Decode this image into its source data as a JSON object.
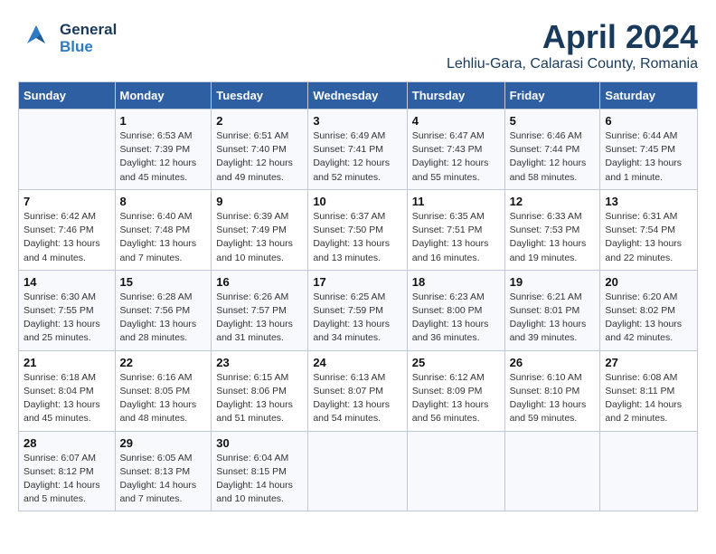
{
  "header": {
    "logo_general": "General",
    "logo_blue": "Blue",
    "month_title": "April 2024",
    "location": "Lehliu-Gara, Calarasi County, Romania"
  },
  "weekdays": [
    "Sunday",
    "Monday",
    "Tuesday",
    "Wednesday",
    "Thursday",
    "Friday",
    "Saturday"
  ],
  "weeks": [
    [
      {
        "day": "",
        "info": ""
      },
      {
        "day": "1",
        "info": "Sunrise: 6:53 AM\nSunset: 7:39 PM\nDaylight: 12 hours\nand 45 minutes."
      },
      {
        "day": "2",
        "info": "Sunrise: 6:51 AM\nSunset: 7:40 PM\nDaylight: 12 hours\nand 49 minutes."
      },
      {
        "day": "3",
        "info": "Sunrise: 6:49 AM\nSunset: 7:41 PM\nDaylight: 12 hours\nand 52 minutes."
      },
      {
        "day": "4",
        "info": "Sunrise: 6:47 AM\nSunset: 7:43 PM\nDaylight: 12 hours\nand 55 minutes."
      },
      {
        "day": "5",
        "info": "Sunrise: 6:46 AM\nSunset: 7:44 PM\nDaylight: 12 hours\nand 58 minutes."
      },
      {
        "day": "6",
        "info": "Sunrise: 6:44 AM\nSunset: 7:45 PM\nDaylight: 13 hours\nand 1 minute."
      }
    ],
    [
      {
        "day": "7",
        "info": "Sunrise: 6:42 AM\nSunset: 7:46 PM\nDaylight: 13 hours\nand 4 minutes."
      },
      {
        "day": "8",
        "info": "Sunrise: 6:40 AM\nSunset: 7:48 PM\nDaylight: 13 hours\nand 7 minutes."
      },
      {
        "day": "9",
        "info": "Sunrise: 6:39 AM\nSunset: 7:49 PM\nDaylight: 13 hours\nand 10 minutes."
      },
      {
        "day": "10",
        "info": "Sunrise: 6:37 AM\nSunset: 7:50 PM\nDaylight: 13 hours\nand 13 minutes."
      },
      {
        "day": "11",
        "info": "Sunrise: 6:35 AM\nSunset: 7:51 PM\nDaylight: 13 hours\nand 16 minutes."
      },
      {
        "day": "12",
        "info": "Sunrise: 6:33 AM\nSunset: 7:53 PM\nDaylight: 13 hours\nand 19 minutes."
      },
      {
        "day": "13",
        "info": "Sunrise: 6:31 AM\nSunset: 7:54 PM\nDaylight: 13 hours\nand 22 minutes."
      }
    ],
    [
      {
        "day": "14",
        "info": "Sunrise: 6:30 AM\nSunset: 7:55 PM\nDaylight: 13 hours\nand 25 minutes."
      },
      {
        "day": "15",
        "info": "Sunrise: 6:28 AM\nSunset: 7:56 PM\nDaylight: 13 hours\nand 28 minutes."
      },
      {
        "day": "16",
        "info": "Sunrise: 6:26 AM\nSunset: 7:57 PM\nDaylight: 13 hours\nand 31 minutes."
      },
      {
        "day": "17",
        "info": "Sunrise: 6:25 AM\nSunset: 7:59 PM\nDaylight: 13 hours\nand 34 minutes."
      },
      {
        "day": "18",
        "info": "Sunrise: 6:23 AM\nSunset: 8:00 PM\nDaylight: 13 hours\nand 36 minutes."
      },
      {
        "day": "19",
        "info": "Sunrise: 6:21 AM\nSunset: 8:01 PM\nDaylight: 13 hours\nand 39 minutes."
      },
      {
        "day": "20",
        "info": "Sunrise: 6:20 AM\nSunset: 8:02 PM\nDaylight: 13 hours\nand 42 minutes."
      }
    ],
    [
      {
        "day": "21",
        "info": "Sunrise: 6:18 AM\nSunset: 8:04 PM\nDaylight: 13 hours\nand 45 minutes."
      },
      {
        "day": "22",
        "info": "Sunrise: 6:16 AM\nSunset: 8:05 PM\nDaylight: 13 hours\nand 48 minutes."
      },
      {
        "day": "23",
        "info": "Sunrise: 6:15 AM\nSunset: 8:06 PM\nDaylight: 13 hours\nand 51 minutes."
      },
      {
        "day": "24",
        "info": "Sunrise: 6:13 AM\nSunset: 8:07 PM\nDaylight: 13 hours\nand 54 minutes."
      },
      {
        "day": "25",
        "info": "Sunrise: 6:12 AM\nSunset: 8:09 PM\nDaylight: 13 hours\nand 56 minutes."
      },
      {
        "day": "26",
        "info": "Sunrise: 6:10 AM\nSunset: 8:10 PM\nDaylight: 13 hours\nand 59 minutes."
      },
      {
        "day": "27",
        "info": "Sunrise: 6:08 AM\nSunset: 8:11 PM\nDaylight: 14 hours\nand 2 minutes."
      }
    ],
    [
      {
        "day": "28",
        "info": "Sunrise: 6:07 AM\nSunset: 8:12 PM\nDaylight: 14 hours\nand 5 minutes."
      },
      {
        "day": "29",
        "info": "Sunrise: 6:05 AM\nSunset: 8:13 PM\nDaylight: 14 hours\nand 7 minutes."
      },
      {
        "day": "30",
        "info": "Sunrise: 6:04 AM\nSunset: 8:15 PM\nDaylight: 14 hours\nand 10 minutes."
      },
      {
        "day": "",
        "info": ""
      },
      {
        "day": "",
        "info": ""
      },
      {
        "day": "",
        "info": ""
      },
      {
        "day": "",
        "info": ""
      }
    ]
  ]
}
